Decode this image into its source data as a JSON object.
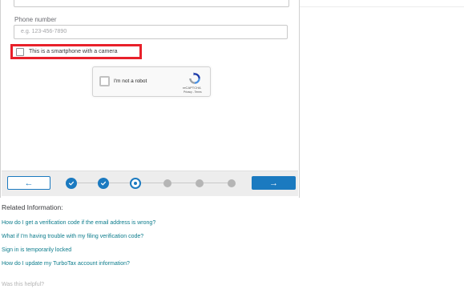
{
  "form": {
    "phone_label": "Phone number",
    "phone_placeholder": "e.g. 123-456-7890",
    "phone_value": "",
    "smartphone_checkbox_label": "This is a smartphone with a camera",
    "smartphone_checked": false
  },
  "recaptcha": {
    "label": "I'm not a robot",
    "brand": "reCAPTCHA",
    "terms": "Privacy - Terms"
  },
  "navigation": {
    "back_label": "←",
    "next_label": "→",
    "steps": [
      "done",
      "done",
      "current",
      "todo",
      "todo",
      "todo"
    ]
  },
  "related": {
    "title": "Related Information:",
    "links": [
      "How do I get a verification code if the email address is wrong?",
      "What if I'm having trouble with my filing verification code?",
      "Sign in is temporarily locked",
      "How do I update my TurboTax account information?"
    ]
  },
  "feedback": {
    "helpful_text": "Was this helpful?"
  },
  "colors": {
    "accent": "#1b7ac0",
    "link": "#0c7c8c",
    "highlight_border": "#e8202a",
    "nav_background": "#ededed"
  }
}
